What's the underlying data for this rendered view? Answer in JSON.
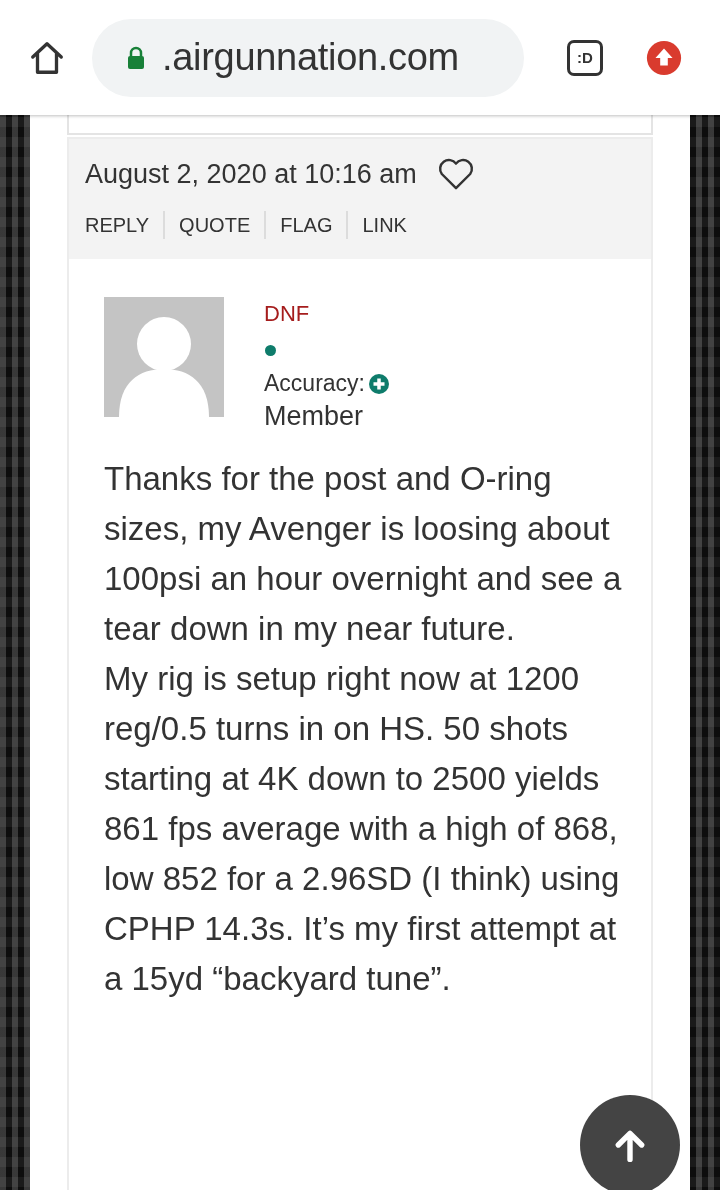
{
  "browser": {
    "url": ".airgunnation.com",
    "tabs_label": ":D"
  },
  "comment": {
    "date": "August 2, 2020 at 10:16 am",
    "liked": false,
    "actions": [
      "REPLY",
      "QUOTE",
      "FLAG",
      "LINK"
    ],
    "author": {
      "name": "DNF",
      "online": true,
      "accuracy_label": "Accuracy:",
      "role": "Member"
    },
    "body": [
      "Thanks for the post and O-ring sizes, my Avenger is loosing about 100psi an hour overnight and see a tear down in my near future.",
      "My rig is setup right now at 1200 reg/0.5 turns in on HS. 50 shots starting at 4K down to 2500 yields 861 fps average with a high of 868, low 852 for a 2.96SD (I think) using CPHP 14.3s. It’s my first attempt at a 15yd “backyard tune”."
    ]
  }
}
